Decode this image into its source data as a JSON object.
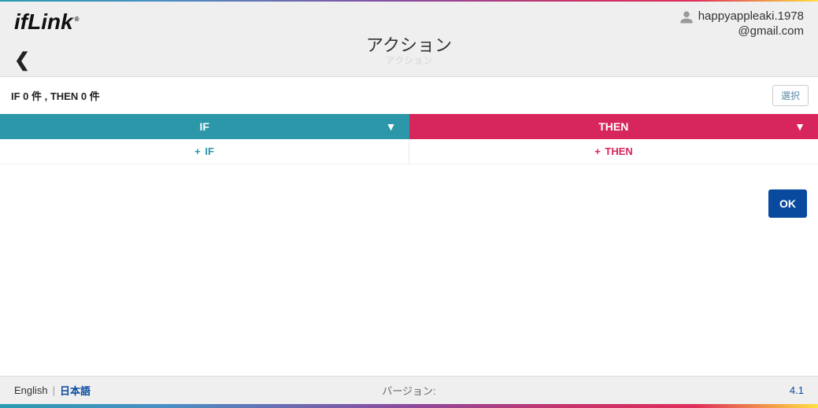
{
  "header": {
    "logo": "ifLink",
    "user_name": "happyappleaki.1978",
    "user_domain": "@gmail.com",
    "title": "アクション",
    "subtitle": "アクション"
  },
  "status": {
    "text": "IF 0 件 , THEN 0 件",
    "select_label": "選択"
  },
  "columns": {
    "if_label": "IF",
    "then_label": "THEN",
    "add_if_label": "IF",
    "add_then_label": "THEN"
  },
  "actions": {
    "ok_label": "OK"
  },
  "footer": {
    "lang_en": "English",
    "lang_jp": "日本語",
    "version_label": "バージョン:",
    "version_value": "4.1"
  }
}
